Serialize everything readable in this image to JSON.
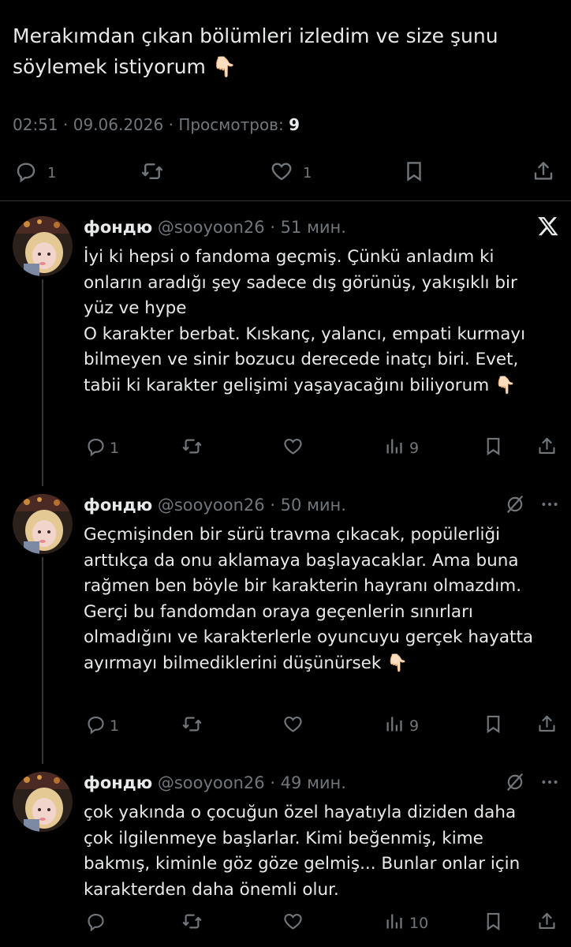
{
  "tweet": {
    "text": "Merakımdan çıkan bölümleri izledim ve size şunu söylemek istiyorum 👇🏻",
    "time": "02:51",
    "date": "09.06.2026",
    "views_label": "Просмотров:",
    "views": "9",
    "actions": {
      "replies": "1",
      "retweets": "",
      "likes": "1"
    }
  },
  "replies": [
    {
      "name": "фондю",
      "handle": "@sooyoon26",
      "time": "51 мин.",
      "text": "İyi ki hepsi o fandoma geçmiş. Çünkü anladım ki onların aradığı şey sadece dış görünüş, yakışıklı bir yüz ve hype\nO karakter berbat. Kıskanç, yalancı, empati kurmayı bilmeyen ve sinir bozucu derecede inatçı biri. Evet, tabii ki karakter gelişimi yaşayacağını biliyorum 👇🏻",
      "corner_icon": "x-logo-icon",
      "replies": "1",
      "retweets": "",
      "likes": "",
      "views": "9"
    },
    {
      "name": "фондю",
      "handle": "@sooyoon26",
      "time": "50 мин.",
      "text": "Geçmişinden bir sürü travma çıkacak, popülerliği arttıkça da onu aklamaya başlayacaklar. Ama buna rağmen ben böyle bir karakterin hayranı olmazdım.\nGerçi bu fandomdan oraya geçenlerin sınırları olmadığını ve karakterlerle oyuncuyu gerçek hayatta ayırmayı bilmediklerini düşünürsek 👇🏻",
      "corner_icon": "grok-icon",
      "replies": "1",
      "retweets": "",
      "likes": "",
      "views": "9"
    },
    {
      "name": "фондю",
      "handle": "@sooyoon26",
      "time": "49 мин.",
      "text": "çok yakında o çocuğun özel hayatıyla diziden daha çok ilgilenmeye başlarlar. Kimi beğenmiş, kime bakmış, kiminle göz göze gelmiş... Bunlar onlar için karakterden daha önemli olur.",
      "corner_icon": "grok-icon",
      "replies": "",
      "retweets": "",
      "likes": "",
      "views": "10"
    }
  ],
  "colors": {
    "background": "#000000",
    "text": "#e7e9ea",
    "muted": "#71767b",
    "divider": "#2f3336"
  }
}
